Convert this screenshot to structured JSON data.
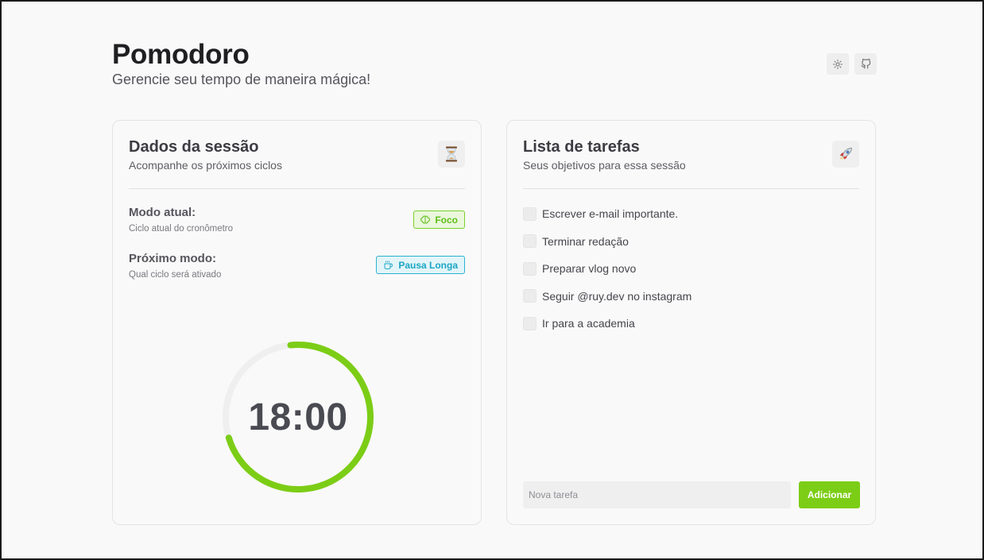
{
  "header": {
    "title": "Pomodoro",
    "subtitle": "Gerencie seu tempo de maneira mágica!",
    "actions": [
      {
        "icon": "sun-icon"
      },
      {
        "icon": "github-icon"
      }
    ]
  },
  "session": {
    "title": "Dados da sessão",
    "subtitle": "Acompanhe os próximos ciclos",
    "emoji": "⏳",
    "current_mode": {
      "label": "Modo atual:",
      "description": "Ciclo atual do cronômetro",
      "badge": "Foco",
      "badge_icon": "brain-icon",
      "color": "#7ccf2d"
    },
    "next_mode": {
      "label": "Próximo modo:",
      "description": "Qual ciclo será ativado",
      "badge": "Pausa Longa",
      "badge_icon": "coffee-icon",
      "color": "#29b3d0"
    },
    "timer": {
      "display": "18:00",
      "progress": 0.72,
      "color": "#7ccd16"
    }
  },
  "tasks": {
    "title": "Lista de tarefas",
    "subtitle": "Seus objetivos para essa sessão",
    "emoji": "🚀",
    "items": [
      {
        "label": "Escrever e-mail importante.",
        "done": false
      },
      {
        "label": "Terminar redação",
        "done": false
      },
      {
        "label": "Preparar vlog novo",
        "done": false
      },
      {
        "label": "Seguir @ruy.dev no instagram",
        "done": false
      },
      {
        "label": "Ir para a academia",
        "done": false
      }
    ],
    "new_task_placeholder": "Nova tarefa",
    "add_label": "Adicionar"
  }
}
